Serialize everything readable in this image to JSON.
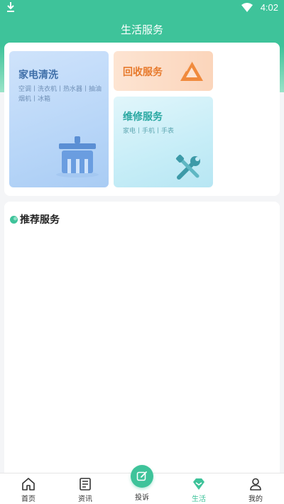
{
  "status_bar": {
    "time": "4:02"
  },
  "header": {
    "title": "生活服务"
  },
  "services": {
    "clean": {
      "title": "家电清洗",
      "subtitle": "空调丨洗衣机丨热水器丨抽油烟机丨冰箱"
    },
    "recycle": {
      "title": "回收服务"
    },
    "repair": {
      "title": "维修服务",
      "subtitle": "家电丨手机丨手表"
    }
  },
  "recommend": {
    "title": "推荐服务"
  },
  "tabbar": {
    "items": [
      {
        "label": "首页",
        "icon": "home-icon"
      },
      {
        "label": "资讯",
        "icon": "news-icon"
      },
      {
        "label": "投诉",
        "icon": "edit-icon"
      },
      {
        "label": "生活",
        "icon": "diamond-icon"
      },
      {
        "label": "我的",
        "icon": "user-icon"
      }
    ],
    "active_index": 3
  },
  "colors": {
    "brand": "#3ec39a",
    "clean_title": "#3f6fa9",
    "recycle_title": "#e77a2c",
    "repair_title": "#2aa8a2"
  }
}
